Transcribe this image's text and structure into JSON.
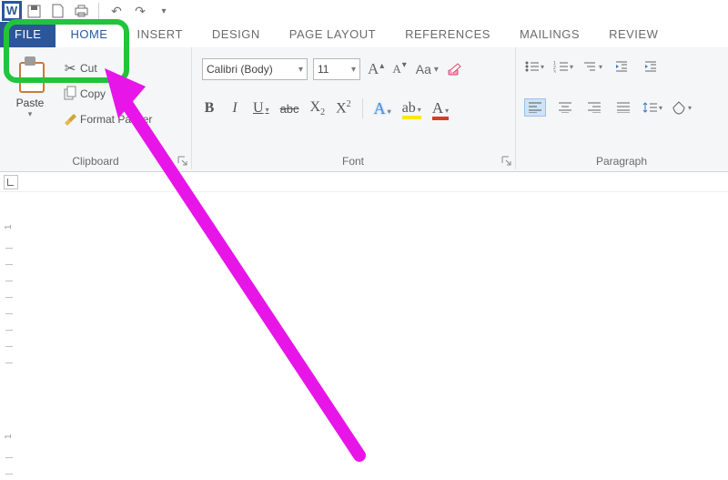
{
  "qat": {
    "undo": "↶",
    "redo": "↷"
  },
  "tabs": {
    "file": "FILE",
    "home": "HOME",
    "insert": "INSERT",
    "design": "DESIGN",
    "page_layout": "PAGE LAYOUT",
    "references": "REFERENCES",
    "mailings": "MAILINGS",
    "review": "REVIEW"
  },
  "clipboard": {
    "paste": "Paste",
    "cut": "Cut",
    "copy": "Copy",
    "format_painter": "Format Painter",
    "group": "Clipboard"
  },
  "font": {
    "name": "Calibri (Body)",
    "size": "11",
    "bold": "B",
    "italic": "I",
    "underline": "U",
    "strike": "abc",
    "sub": "X",
    "sub2": "2",
    "sup": "X",
    "sup2": "2",
    "txfx": "A",
    "hilite": "ab",
    "color": "A",
    "grow": "A",
    "grow_sup": "▴",
    "shrink": "A",
    "shrink_sup": "▾",
    "case": "Aa",
    "group": "Font"
  },
  "paragraph": {
    "group": "Paragraph"
  },
  "ruler": {
    "one": "1"
  },
  "colors": {
    "accent": "#2b579a",
    "highlight_green": "#21c43a",
    "arrow": "#e815e8"
  }
}
